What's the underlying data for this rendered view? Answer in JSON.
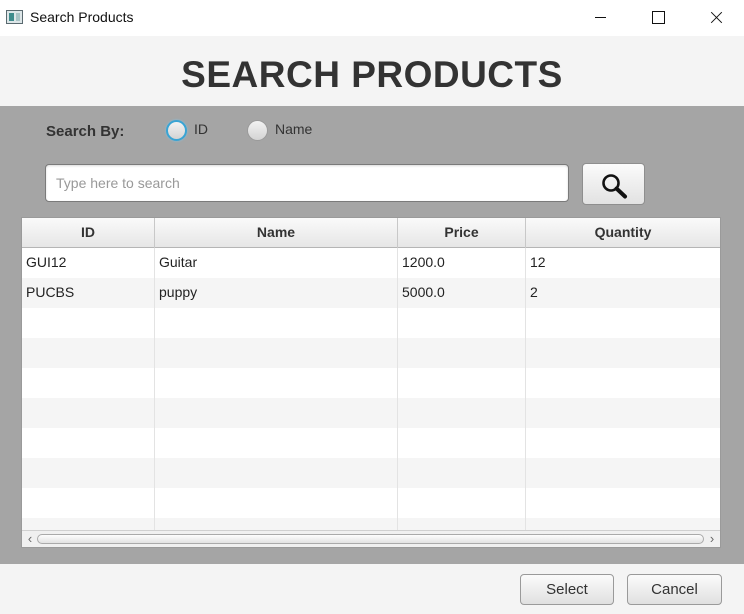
{
  "window": {
    "title": "Search Products",
    "controls": [
      "minimize",
      "maximize",
      "close"
    ]
  },
  "header": {
    "title": "SEARCH PRODUCTS"
  },
  "search": {
    "by_label": "Search By:",
    "options": [
      {
        "label": "ID",
        "selected": true
      },
      {
        "label": "Name",
        "selected": false
      }
    ],
    "value": "",
    "placeholder": "Type here to search",
    "button_icon": "search-icon"
  },
  "table": {
    "columns": [
      "ID",
      "Name",
      "Price",
      "Quantity"
    ],
    "rows": [
      [
        "GUI12",
        "Guitar",
        "1200.0",
        "12"
      ],
      [
        "PUCBS",
        "puppy",
        "5000.0",
        "2"
      ]
    ]
  },
  "footer": {
    "select_label": "Select",
    "cancel_label": "Cancel"
  },
  "colors": {
    "content_bg": "#a5a5a5",
    "header_bg": "#f4f4f4",
    "radio_focus": "#39a4d4",
    "title_text": "#333333"
  }
}
